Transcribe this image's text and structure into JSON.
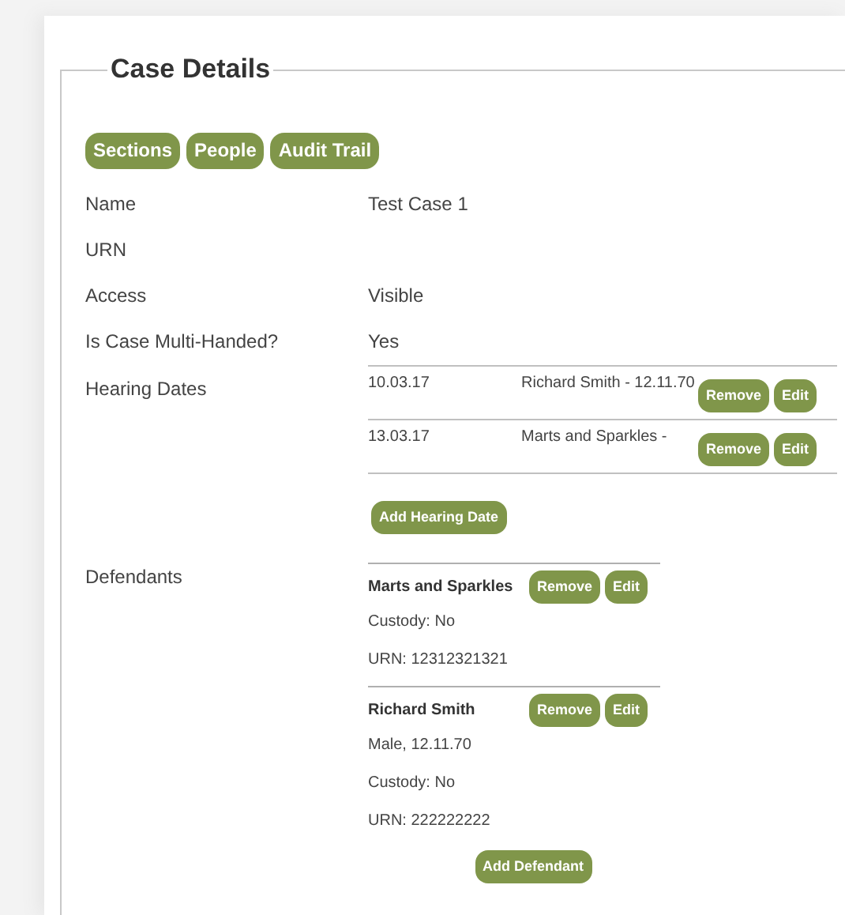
{
  "section": {
    "title": "Case Details"
  },
  "nav_buttons": [
    "Sections",
    "People",
    "Audit Trail"
  ],
  "fields": [
    {
      "label": "Name",
      "value": "Test Case 1"
    },
    {
      "label": "URN"
    },
    {
      "label": "Access",
      "value": "Visible"
    },
    {
      "label": "Is Case Multi-Handed?",
      "value": "Yes"
    }
  ],
  "hearing_dates": {
    "label": "Hearing Dates",
    "rows": [
      {
        "date": "10.03.17",
        "party": "Richard Smith - 12.11.70",
        "buttons": [
          "Remove",
          "Edit"
        ]
      },
      {
        "date": "13.03.17",
        "party": "Marts and Sparkles -",
        "buttons": [
          "Remove",
          "Edit"
        ]
      }
    ],
    "add_button": "Add Hearing Date"
  },
  "defendants": {
    "label": "Defendants",
    "items": [
      {
        "name": "Marts and Sparkles",
        "details": [
          "Custody: No",
          "URN: 12312321321"
        ],
        "buttons": [
          "Remove",
          "Edit"
        ]
      },
      {
        "name": "Richard Smith",
        "details": [
          "Male, 12.11.70",
          "Custody: No",
          "URN: 222222222"
        ],
        "buttons": [
          "Remove",
          "Edit"
        ]
      }
    ],
    "add_button": "Add Defendant"
  }
}
